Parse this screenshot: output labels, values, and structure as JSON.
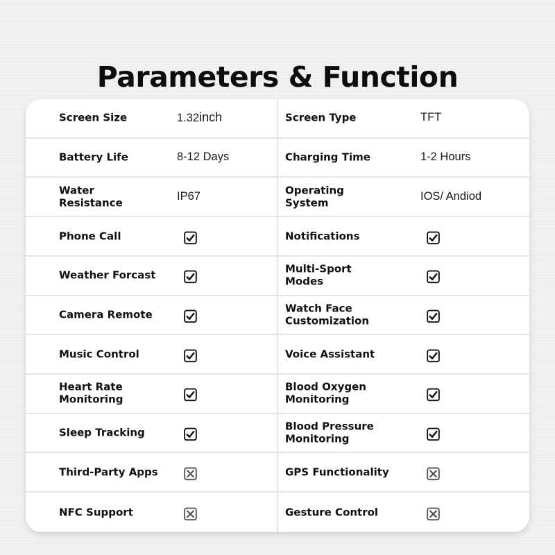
{
  "title": "Parameters & Function",
  "colors": {
    "background": "#efefef",
    "card": "#ffffff",
    "divider": "#e4e4e4",
    "text": "#111111",
    "check": "#111111",
    "cross": "#555555"
  },
  "rows": [
    {
      "left": {
        "label": "Screen Size",
        "type": "text",
        "value": "1.32",
        "unit": "inch"
      },
      "right": {
        "label": "Screen Type",
        "type": "text",
        "value": "TFT",
        "unit": ""
      }
    },
    {
      "left": {
        "label": "Battery Life",
        "type": "text",
        "value": "8-12 Days",
        "unit": ""
      },
      "right": {
        "label": "Charging Time",
        "type": "text",
        "value": "1-2 Hours",
        "unit": ""
      }
    },
    {
      "left": {
        "label": "Water\nResistance",
        "type": "text",
        "value": "IP67",
        "unit": ""
      },
      "right": {
        "label": "Operating\nSystem",
        "type": "text",
        "value": "IOS/ Andiod",
        "unit": ""
      }
    },
    {
      "left": {
        "label": "Phone Call",
        "type": "check",
        "supported": true
      },
      "right": {
        "label": "Notifications",
        "type": "check",
        "supported": true
      }
    },
    {
      "left": {
        "label": "Weather Forcast",
        "type": "check",
        "supported": true
      },
      "right": {
        "label": "Multi-Sport\nModes",
        "type": "check",
        "supported": true
      }
    },
    {
      "left": {
        "label": "Camera Remote",
        "type": "check",
        "supported": true
      },
      "right": {
        "label": "Watch Face\nCustomization",
        "type": "check",
        "supported": true
      }
    },
    {
      "left": {
        "label": "Music Control",
        "type": "check",
        "supported": true
      },
      "right": {
        "label": "Voice Assistant",
        "type": "check",
        "supported": true
      }
    },
    {
      "left": {
        "label": "Heart Rate\nMonitoring",
        "type": "check",
        "supported": true
      },
      "right": {
        "label": "Blood Oxygen\nMonitoring",
        "type": "check",
        "supported": true
      }
    },
    {
      "left": {
        "label": "Sleep Tracking",
        "type": "check",
        "supported": true
      },
      "right": {
        "label": "Blood Pressure\nMonitoring",
        "type": "check",
        "supported": true
      }
    },
    {
      "left": {
        "label": "Third-Party Apps",
        "type": "check",
        "supported": false
      },
      "right": {
        "label": "GPS Functionality",
        "type": "check",
        "supported": false
      }
    },
    {
      "left": {
        "label": "NFC Support",
        "type": "check",
        "supported": false
      },
      "right": {
        "label": "Gesture Control",
        "type": "check",
        "supported": false
      }
    }
  ]
}
